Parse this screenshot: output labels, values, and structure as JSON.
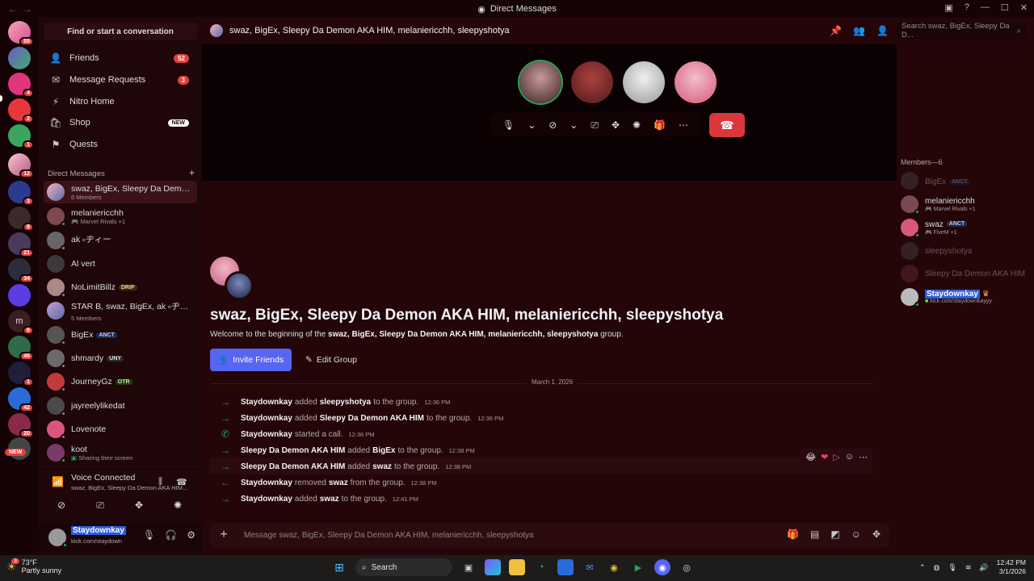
{
  "window": {
    "title": "Direct Messages"
  },
  "rail": {
    "badges": [
      "55",
      "",
      "4",
      "2",
      "1",
      "12",
      "3",
      "8",
      "21",
      "34",
      "",
      "6",
      "46",
      "1",
      "42",
      "20",
      "",
      ""
    ]
  },
  "sidebar": {
    "find_label": "Find or start a conversation",
    "nav": [
      {
        "label": "Friends",
        "badge": "52"
      },
      {
        "label": "Message Requests",
        "badge": "3"
      },
      {
        "label": "Nitro Home",
        "badge": ""
      },
      {
        "label": "Shop",
        "badge": "NEW"
      },
      {
        "label": "Quests",
        "badge": ""
      }
    ],
    "dm_header": "Direct Messages",
    "dms": [
      {
        "name": "swaz, BigEx, Sleepy Da Demon AKA HIM, melaniericchh, sleepyshotya",
        "sub": "6 Members",
        "tag": ""
      },
      {
        "name": "melaniericchh",
        "sub": "Marvel Rivals +1",
        "tag": ""
      },
      {
        "name": "ak ৹ヂィー",
        "sub": "",
        "tag": ""
      },
      {
        "name": "Al vert",
        "sub": "",
        "tag": ""
      },
      {
        "name": "NoLimitBillz",
        "sub": "",
        "tag": "DRIP"
      },
      {
        "name": "STAR B, swaz, BigEx, ak ৹ヂィー",
        "sub": "5 Members",
        "tag": ""
      },
      {
        "name": "BigEx",
        "sub": "",
        "tag": "ANCT"
      },
      {
        "name": "shmardy",
        "sub": "",
        "tag": "UNY"
      },
      {
        "name": "JourneyGz",
        "sub": "",
        "tag": "OTR"
      },
      {
        "name": "jayreelylikedat",
        "sub": "",
        "tag": ""
      },
      {
        "name": "Lovenote",
        "sub": "",
        "tag": ""
      },
      {
        "name": "koot",
        "sub": "Sharing their screen",
        "tag": ""
      }
    ],
    "new_label": "NEW",
    "voice": {
      "title": "Voice Connected",
      "sub": "swaz, BigEx, Sleepy Da Demon AKA HIM..."
    },
    "user": {
      "name": "Staydownkay",
      "status": "kick.com/staydown"
    }
  },
  "main": {
    "header_title": "swaz, BigEx, Sleepy Da Demon AKA HIM, melaniericchh, sleepyshotya",
    "search_placeholder": "Search swaz, BigEx, Sleepy Da D...",
    "group_title": "swaz, BigEx, Sleepy Da Demon AKA HIM, melaniericchh, sleepyshotya",
    "welcome_prefix": "Welcome to the beginning of the",
    "welcome_names": "swaz, BigEx, Sleepy Da Demon AKA HIM, melaniericchh, sleepyshotya",
    "welcome_suffix": "group.",
    "invite_label": "Invite Friends",
    "edit_label": "Edit Group",
    "date_divider": "March 1, 2026",
    "messages": [
      {
        "actor": "Staydownkay",
        "verb": "added",
        "target": "sleepyshotya",
        "rest": "to the group.",
        "time": "12:36 PM"
      },
      {
        "actor": "Staydownkay",
        "verb": "added",
        "target": "Sleepy Da Demon AKA HIM",
        "rest": "to the group.",
        "time": "12:36 PM"
      },
      {
        "actor": "Staydownkay",
        "verb": "started a call.",
        "target": "",
        "rest": "",
        "time": "12:36 PM"
      },
      {
        "actor": "Sleepy Da Demon AKA HIM",
        "verb": "added",
        "target": "BigEx",
        "rest": "to the group.",
        "time": "12:38 PM"
      },
      {
        "actor": "Sleepy Da Demon AKA HIM",
        "verb": "added",
        "target": "swaz",
        "rest": "to the group.",
        "time": "12:38 PM"
      },
      {
        "actor": "Staydownkay",
        "verb": "removed",
        "target": "swaz",
        "rest": "from the group.",
        "time": "12:38 PM"
      },
      {
        "actor": "Staydownkay",
        "verb": "added",
        "target": "swaz",
        "rest": "to the group.",
        "time": "12:41 PM"
      }
    ],
    "composer_placeholder": "Message swaz, BigEx, Sleepy Da Demon AKA HIM, melaniericchh, sleepyshotya"
  },
  "members": {
    "header": "Members—6",
    "list": [
      {
        "name": "BigEx",
        "sub": "",
        "tag": "ANCT",
        "online": false
      },
      {
        "name": "melaniericchh",
        "sub": "Marvel Rivals +1",
        "tag": "",
        "online": true
      },
      {
        "name": "swaz",
        "sub": "FiveM +1",
        "tag": "ANCT",
        "online": true
      },
      {
        "name": "sleepyshotya",
        "sub": "",
        "tag": "",
        "online": false
      },
      {
        "name": "Sleepy Da Demon AKA HIM",
        "sub": "",
        "tag": "",
        "online": false
      },
      {
        "name": "Staydownkay",
        "sub": "kick.com/staydownkayyy",
        "tag": "",
        "online": true
      }
    ]
  },
  "taskbar": {
    "weather_temp": "73°F",
    "weather_desc": "Partly sunny",
    "weather_badge": "3",
    "search_label": "Search",
    "time": "12:42 PM",
    "date": "3/1/2026"
  },
  "colors": {
    "accent": "#5865f2",
    "danger": "#da373c",
    "online": "#23a55a",
    "background": "#240609"
  }
}
